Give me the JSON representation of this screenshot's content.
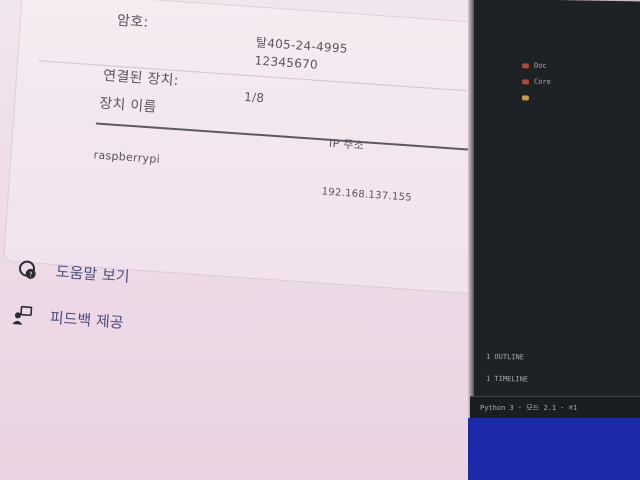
{
  "device_info": {
    "password_label": "암호:",
    "password_value_1": "탈405-24-4995",
    "password_value_2": "12345670",
    "connected_devices_label": "연결된 장치:",
    "connected_devices_value": "1/8",
    "device_name_header": "장치 이름",
    "ip_header": "IP 주소",
    "device_name": "raspberrypi",
    "ip_address": "192.168.137.155"
  },
  "actions": {
    "help_label": "도움말 보기",
    "feedback_label": "피드백 제공"
  },
  "terminal": {
    "lines": [
      "Doc",
      "Core",
      "",
      "1 OUTLINE",
      "1 TIMELINE"
    ],
    "status_text": "Python 3 · 모드 2.1 · ⌘1"
  },
  "colors": {
    "panel_bg": "#f0e3ec",
    "text": "#5b5560",
    "link": "#4d4f7c",
    "terminal_bg": "#1d2224",
    "taskbar": "#1c2aa8"
  }
}
